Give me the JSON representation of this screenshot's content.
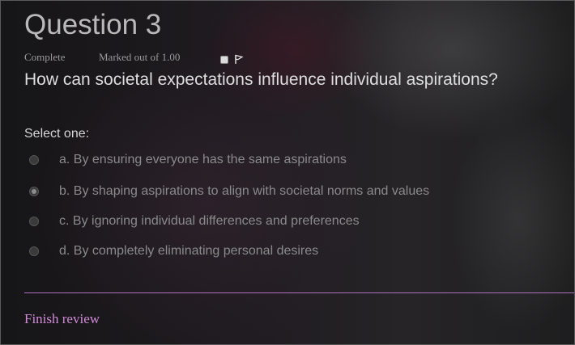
{
  "question": {
    "title": "Question 3",
    "state": "Complete",
    "grade": "Marked out of 1.00",
    "text": "How can societal expectations influence individual aspirations?",
    "prompt": "Select one:",
    "options": [
      {
        "label": "a. By ensuring everyone has the same aspirations",
        "selected": false
      },
      {
        "label": "b. By shaping aspirations to align with societal norms and values",
        "selected": true
      },
      {
        "label": "c. By ignoring individual differences and preferences",
        "selected": false
      },
      {
        "label": "d. By completely eliminating personal desires",
        "selected": false
      }
    ]
  },
  "footer": {
    "finish_label": "Finish review"
  },
  "colors": {
    "link": "#d28bd9",
    "divider": "#b070c0"
  },
  "icons": {
    "flag": "flag-icon"
  }
}
